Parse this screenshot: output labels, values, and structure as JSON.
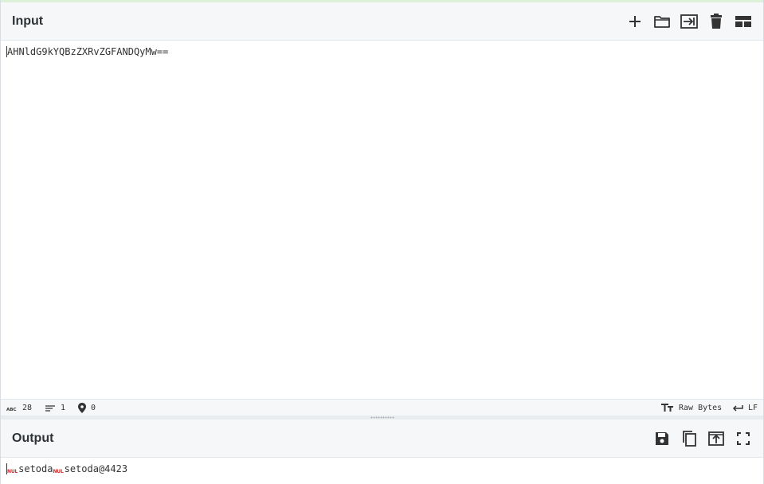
{
  "input": {
    "title": "Input",
    "toolbar": {
      "icons": [
        "plus-icon",
        "folder-icon",
        "insert-file-icon",
        "trash-icon",
        "layout-icon"
      ]
    },
    "text": "AHNldG9kYQBzZXRvZGFANDQyMw=="
  },
  "status": {
    "length": "28",
    "lines": "1",
    "position": "0",
    "encoding": "Raw Bytes",
    "line_ending": "LF"
  },
  "output": {
    "title": "Output",
    "toolbar": {
      "icons": [
        "save-icon",
        "copy-icon",
        "replace-input-icon",
        "fullscreen-icon"
      ]
    },
    "segments": [
      {
        "type": "nul",
        "text": "NUL"
      },
      {
        "type": "text",
        "text": "setoda"
      },
      {
        "type": "nul",
        "text": "NUL"
      },
      {
        "type": "text",
        "text": "setoda@4423"
      }
    ]
  },
  "colors": {
    "header_bg": "#f6f7f8",
    "accent_top": "#dff0d8",
    "nul_red": "#d12a2a",
    "text": "#333333"
  }
}
